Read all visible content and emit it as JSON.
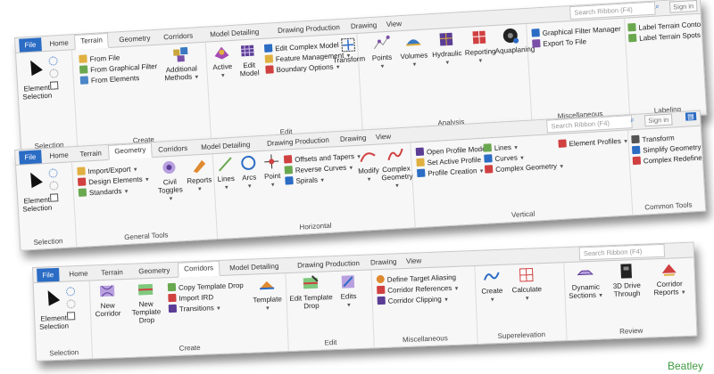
{
  "colors": {
    "file_tab": "#2b6cc4",
    "accent_blue": "#2b6cc4",
    "bg": "#ffffff",
    "ribbon": "#f7f7f7",
    "tail_text": "#3f9a3f"
  },
  "ribbon1": {
    "tabs": [
      "File",
      "Home",
      "Terrain",
      "Geometry",
      "Corridors",
      "Model Detailing",
      "Drawing Production",
      "Drawing",
      "View"
    ],
    "active_tab": "Terrain",
    "search_placeholder": "Search Ribbon (F4)",
    "sign_in": "Sign in",
    "selection": {
      "label": "Element Selection",
      "group": "Selection"
    },
    "create": {
      "items": [
        "From File",
        "From Graphical Filter",
        "From Elements"
      ],
      "big": "Additional Methods",
      "group": "Create"
    },
    "edit": {
      "active": "Active",
      "edit_model": "Edit Model",
      "items": [
        "Edit Complex Model",
        "Feature Management",
        "Boundary Options"
      ],
      "transform": "Transform",
      "group": "Edit"
    },
    "analysis": {
      "items": [
        "Points",
        "Volumes",
        "Hydraulic",
        "Reporting",
        "Aquaplaning"
      ],
      "group": "Analysis"
    },
    "misc": {
      "items": [
        "Graphical Filter Manager",
        "Export To File"
      ],
      "group": "Miscellaneous"
    },
    "labeling": {
      "items": [
        "Label Terrain Contours",
        "Label Terrain Spots"
      ],
      "group": "Labeling"
    }
  },
  "ribbon2": {
    "tabs": [
      "File",
      "Home",
      "Terrain",
      "Geometry",
      "Corridors",
      "Model Detailing",
      "Drawing Production",
      "Drawing",
      "View"
    ],
    "active_tab": "Geometry",
    "search_placeholder": "Search Ribbon (F4)",
    "sign_in": "Sign in",
    "selection": {
      "label": "Element Selection",
      "group": "Selection"
    },
    "general": {
      "items": [
        "Import/Export",
        "Design Elements",
        "Standards"
      ],
      "civil_toggles": "Civil Toggles",
      "reports": "Reports",
      "group": "General Tools"
    },
    "horizontal": {
      "big": [
        "Lines",
        "Arcs",
        "Point"
      ],
      "items": [
        "Offsets and Tapers",
        "Reverse Curves",
        "Spirals"
      ],
      "modify": "Modify",
      "complex_geometry": "Complex Geometry",
      "group": "Horizontal"
    },
    "vertical": {
      "items": [
        "Open Profile Model",
        "Set Active Profile",
        "Profile Creation"
      ],
      "items2": [
        "Lines",
        "Curves",
        "Complex Geometry"
      ],
      "element_profiles": "Element Profiles",
      "group": "Vertical"
    },
    "common": {
      "items": [
        "Transform",
        "Simplify Geometry",
        "Complex Redefine"
      ],
      "group": "Common Tools"
    }
  },
  "ribbon3": {
    "tabs": [
      "File",
      "Home",
      "Terrain",
      "Geometry",
      "Corridors",
      "Model Detailing",
      "Drawing Production",
      "Drawing",
      "View"
    ],
    "active_tab": "Corridors",
    "search_placeholder": "Search Ribbon (F4)",
    "selection": {
      "label": "Element Selection",
      "group": "Selection"
    },
    "create": {
      "big": [
        "New Corridor",
        "New Template Drop"
      ],
      "items": [
        "Copy Template Drop",
        "Import IRD",
        "Transitions"
      ],
      "template": "Template",
      "group": "Create"
    },
    "edit": {
      "big": "Edit Template Drop",
      "edits": "Edits",
      "group": "Edit"
    },
    "misc": {
      "items": [
        "Define Target Aliasing",
        "Corridor References",
        "Corridor Clipping"
      ],
      "group": "Miscellaneous"
    },
    "superelevation": {
      "items": [
        "Create",
        "Calculate"
      ],
      "group": "Superelevation"
    },
    "review": {
      "items": [
        "Dynamic Sections",
        "3D Drive Through",
        "Corridor Reports"
      ],
      "group": "Review"
    }
  },
  "bottom_right_text": "Beatley"
}
